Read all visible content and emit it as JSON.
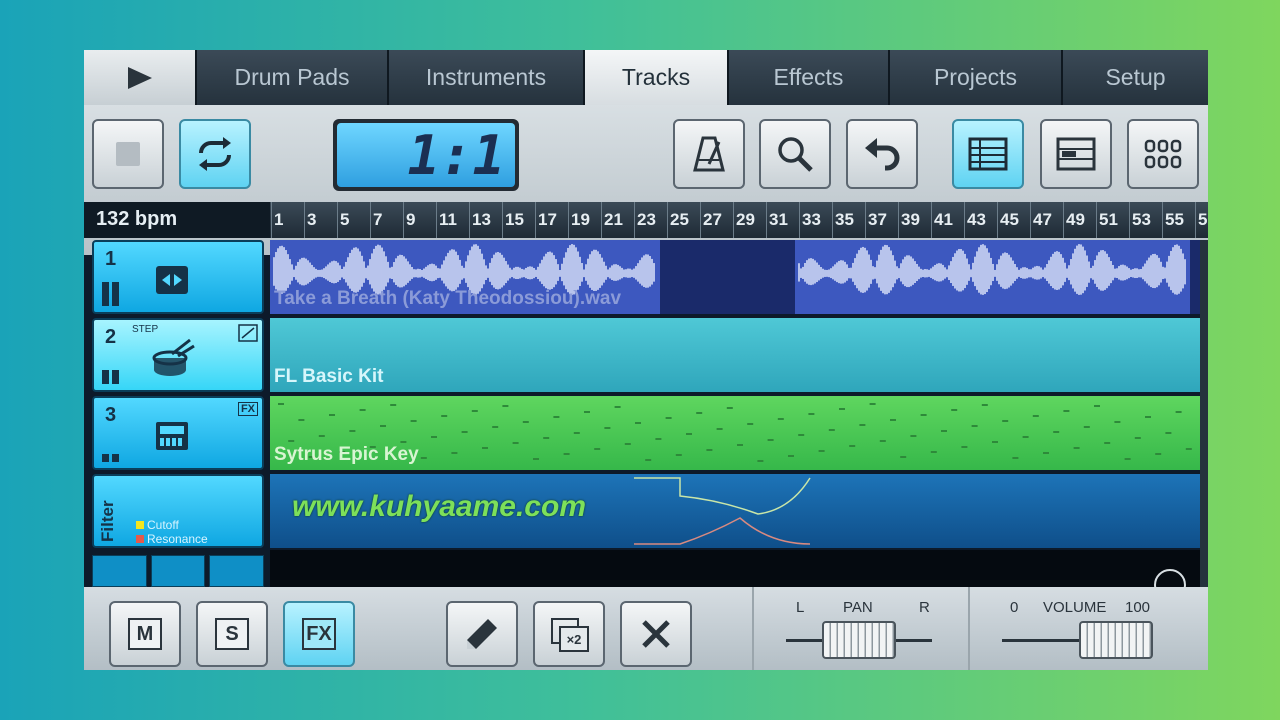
{
  "tabs": [
    {
      "label": "Drum Pads"
    },
    {
      "label": "Instruments"
    },
    {
      "label": "Tracks"
    },
    {
      "label": "Effects"
    },
    {
      "label": "Projects"
    },
    {
      "label": "Setup"
    }
  ],
  "active_tab": "Tracks",
  "lcd": {
    "position": "1:1"
  },
  "ruler": {
    "bpm": "132 bpm",
    "marks": [
      "1",
      "3",
      "5",
      "7",
      "9",
      "11",
      "13",
      "15",
      "17",
      "19",
      "21",
      "23",
      "25",
      "27",
      "29",
      "31",
      "33",
      "35",
      "37",
      "39",
      "41",
      "43",
      "45",
      "47",
      "49",
      "51",
      "53",
      "55",
      "5"
    ]
  },
  "tracks": [
    {
      "number": "1",
      "badge": "",
      "name": "Take a Breath (Katy Theodossiou).wav",
      "color": "#3a54b5"
    },
    {
      "number": "2",
      "badge": "STEP",
      "name": "FL Basic Kit",
      "color": "#3cbacd"
    },
    {
      "number": "3",
      "badge": "FX",
      "name": "Sytrus Epic Key",
      "color": "#46c55a"
    }
  ],
  "automation": {
    "label": "Filter",
    "legend": [
      {
        "name": "Cutoff",
        "color": "#f3e61f"
      },
      {
        "name": "Resonance",
        "color": "#e65a4a"
      }
    ]
  },
  "bottom": {
    "mute_label": "M",
    "solo_label": "S",
    "fx_label": "FX",
    "copy_label": "×2",
    "pan": {
      "title": "PAN",
      "left": "L",
      "right": "R",
      "value": 0.5
    },
    "volume": {
      "title": "VOLUME",
      "min": "0",
      "max": "100",
      "value": 0.78
    }
  },
  "watermark": "www.kuhyaame.com"
}
